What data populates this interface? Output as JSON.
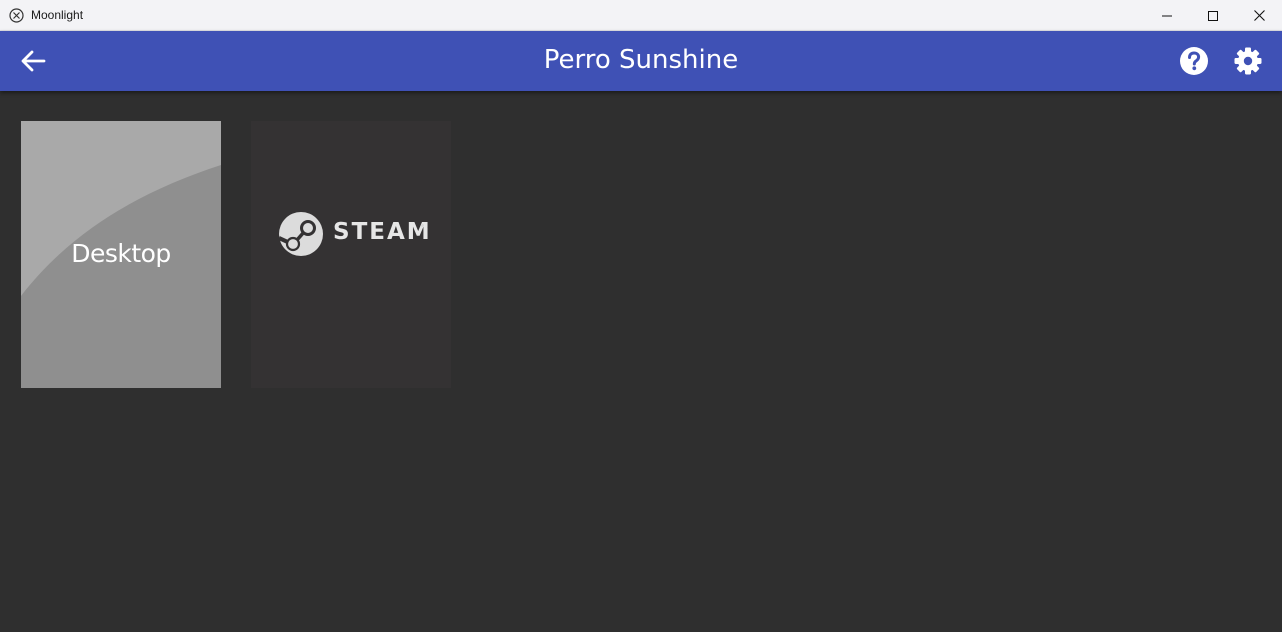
{
  "window": {
    "title": "Moonlight",
    "icon": "moonlight-logo-icon"
  },
  "toolbar": {
    "title": "Perro Sunshine",
    "accent_color": "#3f51b5",
    "back_icon": "arrow-left-icon",
    "help_icon": "help-circle-icon",
    "settings_icon": "gear-icon"
  },
  "apps": [
    {
      "label": "Desktop",
      "tile_color": "#8f8f8f"
    },
    {
      "label": "STEAM",
      "tile_color": "#343233",
      "icon": "steam-logo-icon"
    }
  ],
  "colors": {
    "background": "#2f2f2f",
    "titlebar": "#f3f3f6"
  }
}
